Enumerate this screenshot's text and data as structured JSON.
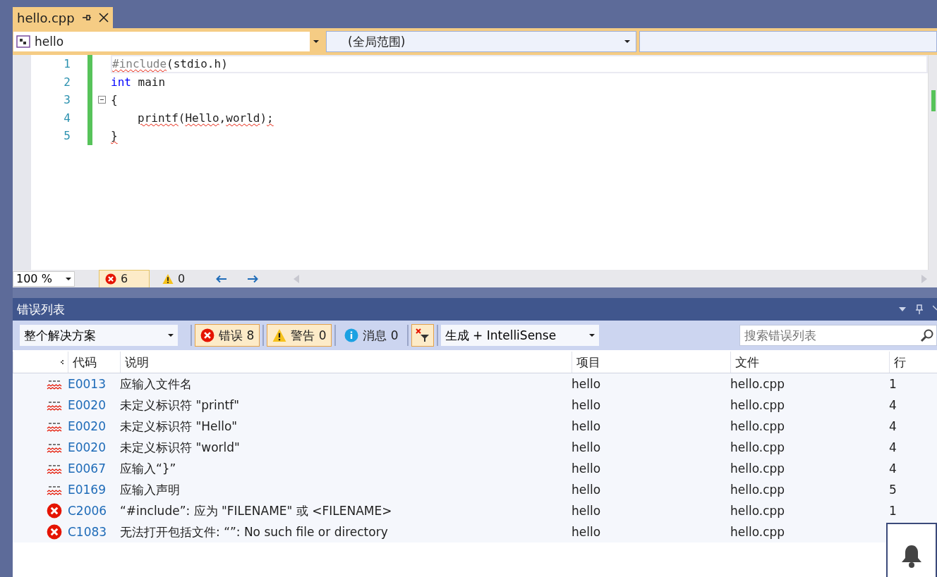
{
  "tabs": [
    {
      "label": "hello.cpp",
      "selected": true
    }
  ],
  "nav": {
    "project": "hello",
    "scope": "(全局范围)"
  },
  "code_lines": [
    {
      "number": "1",
      "fold_marker": false,
      "current": true,
      "tokens": [
        {
          "text": "#include",
          "kind": "preproc",
          "error": true
        },
        {
          "text": "(stdio.h)",
          "kind": "plain",
          "error": false
        }
      ]
    },
    {
      "number": "2",
      "fold_marker": false,
      "current": false,
      "tokens": [
        {
          "text": "int",
          "kind": "keyword",
          "error": false
        },
        {
          "text": " main",
          "kind": "plain",
          "error": false
        }
      ]
    },
    {
      "number": "3",
      "fold_marker": true,
      "current": false,
      "tokens": [
        {
          "text": "{",
          "kind": "plain",
          "error": false
        }
      ]
    },
    {
      "number": "4",
      "fold_marker": false,
      "current": false,
      "indented": true,
      "tokens": [
        {
          "text": "printf",
          "kind": "plain",
          "error": true
        },
        {
          "text": "(",
          "kind": "plain",
          "error": false
        },
        {
          "text": "Hello",
          "kind": "plain",
          "error": true
        },
        {
          "text": ",",
          "kind": "plain",
          "error": false
        },
        {
          "text": "world",
          "kind": "plain",
          "error": true
        },
        {
          "text": ")",
          "kind": "plain",
          "error": false
        },
        {
          "text": ";",
          "kind": "plain",
          "error": true
        }
      ]
    },
    {
      "number": "5",
      "fold_marker": false,
      "current": false,
      "tokens": [
        {
          "text": "}",
          "kind": "plain",
          "error": true
        }
      ]
    }
  ],
  "editor_status": {
    "zoom": "100 %",
    "errors": "6",
    "warnings": "0"
  },
  "error_list": {
    "title": "错误列表",
    "scope": "整个解决方案",
    "filters": [
      {
        "kind": "error",
        "label": "错误 8",
        "selected": true
      },
      {
        "kind": "warning",
        "label": "警告 0",
        "selected": true
      },
      {
        "kind": "info",
        "label": "消息 0",
        "selected": false
      }
    ],
    "open_docs_filter": {
      "selected": true
    },
    "source": "生成 + IntelliSense",
    "search_placeholder": "搜索错误列表",
    "columns": [
      "代码",
      "说明",
      "项目",
      "文件",
      "行"
    ],
    "rows": [
      {
        "kind": "intellisense",
        "code": "E0013",
        "description": "应输入文件名",
        "project": "hello",
        "file": "hello.cpp",
        "line": "1"
      },
      {
        "kind": "intellisense",
        "code": "E0020",
        "description": "未定义标识符 \"printf\"",
        "project": "hello",
        "file": "hello.cpp",
        "line": "4"
      },
      {
        "kind": "intellisense",
        "code": "E0020",
        "description": "未定义标识符 \"Hello\"",
        "project": "hello",
        "file": "hello.cpp",
        "line": "4"
      },
      {
        "kind": "intellisense",
        "code": "E0020",
        "description": "未定义标识符 \"world\"",
        "project": "hello",
        "file": "hello.cpp",
        "line": "4"
      },
      {
        "kind": "intellisense",
        "code": "E0067",
        "description": "应输入“}”",
        "project": "hello",
        "file": "hello.cpp",
        "line": "4"
      },
      {
        "kind": "intellisense",
        "code": "E0169",
        "description": "应输入声明",
        "project": "hello",
        "file": "hello.cpp",
        "line": "5"
      },
      {
        "kind": "build",
        "code": "C2006",
        "description": "“#include”: 应为 \"FILENAME\" 或 <FILENAME>",
        "project": "hello",
        "file": "hello.cpp",
        "line": "1"
      },
      {
        "kind": "build",
        "code": "C1083",
        "description": "无法打开包括文件: “”: No such file or directory",
        "project": "hello",
        "file": "hello.cpp"
      }
    ]
  }
}
